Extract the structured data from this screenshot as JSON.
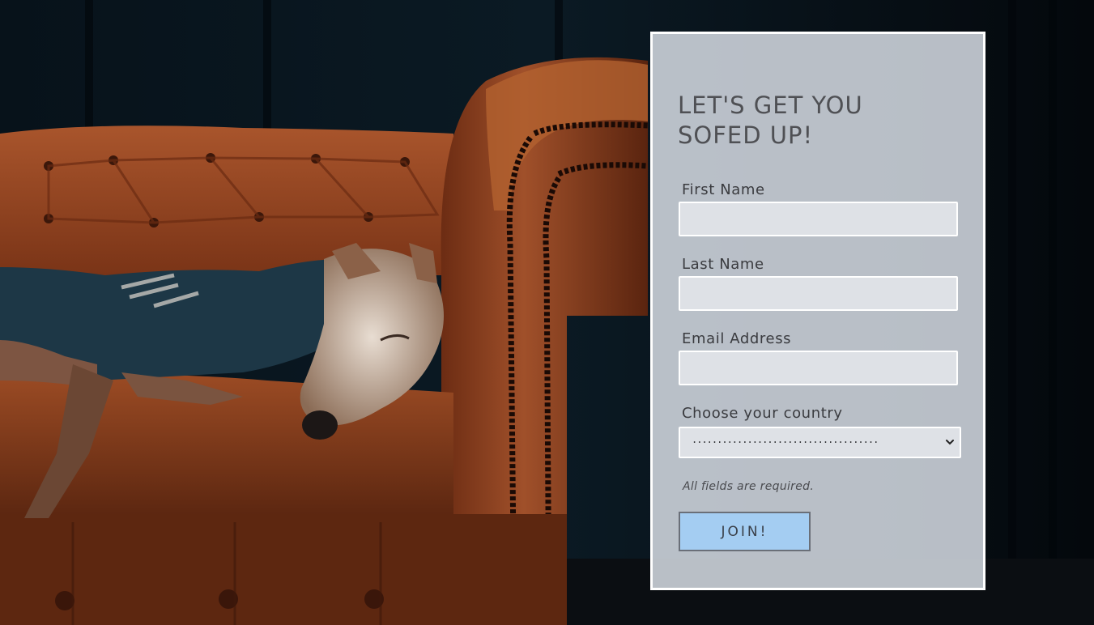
{
  "signup": {
    "title_line1": "LET'S GET YOU",
    "title_line2": "SOFED UP!",
    "fields": {
      "first_name": {
        "label": "First Name",
        "value": ""
      },
      "last_name": {
        "label": "Last Name",
        "value": ""
      },
      "email": {
        "label": "Email Address",
        "value": ""
      },
      "country": {
        "label": "Choose your country",
        "selected": "....................................."
      }
    },
    "required_note": "All fields are required.",
    "submit_label": "JOIN!"
  },
  "colors": {
    "card_background": "#d6dce4",
    "card_border": "#ffffff",
    "button_background": "#a4cdf2",
    "sofa_leather": "#8a3f1f",
    "page_background": "#06090d"
  },
  "icons": {
    "select_arrow": "chevron-down-icon"
  },
  "background": {
    "subject": "greyhound-on-leather-chesterfield-sofa"
  }
}
